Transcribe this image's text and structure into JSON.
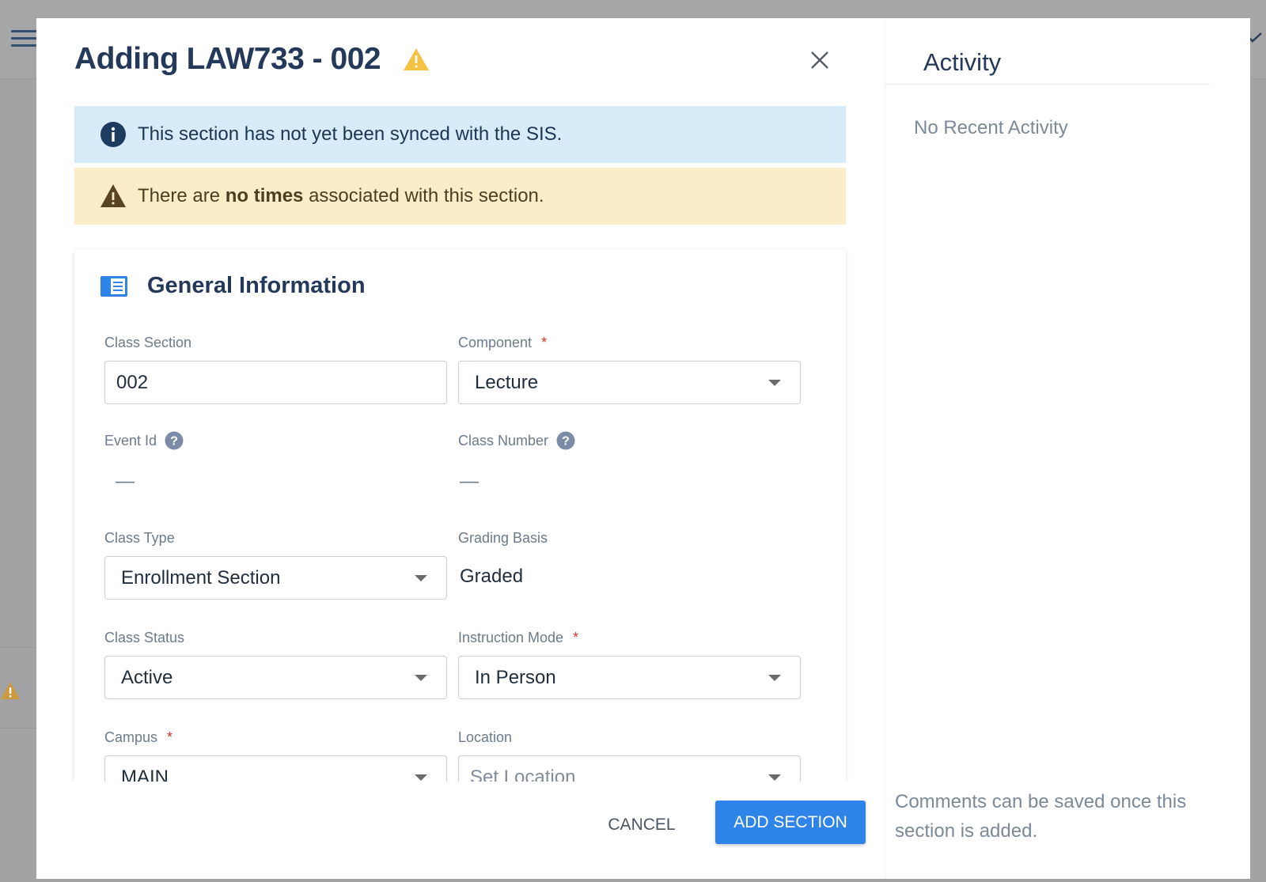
{
  "modal": {
    "title": "Adding LAW733 - 002"
  },
  "alerts": {
    "info_text": "This section has not yet been synced with the SIS.",
    "warn_prefix": "There are ",
    "warn_bold": "no times",
    "warn_suffix": " associated with this section."
  },
  "general": {
    "heading": "General Information",
    "class_section": {
      "label": "Class Section",
      "value": "002"
    },
    "component": {
      "label": "Component",
      "required": "*",
      "value": "Lecture"
    },
    "event_id": {
      "label": "Event Id",
      "value": "—"
    },
    "class_number": {
      "label": "Class Number",
      "value": "—"
    },
    "class_type": {
      "label": "Class Type",
      "value": "Enrollment Section"
    },
    "grading_basis": {
      "label": "Grading Basis",
      "value": "Graded"
    },
    "class_status": {
      "label": "Class Status",
      "value": "Active"
    },
    "instruction_mode": {
      "label": "Instruction Mode",
      "required": "*",
      "value": "In Person"
    },
    "campus": {
      "label": "Campus",
      "required": "*",
      "value": "MAIN"
    },
    "location": {
      "label": "Location",
      "placeholder": "Set Location"
    }
  },
  "footer": {
    "cancel_label": "CANCEL",
    "add_label": "ADD SECTION"
  },
  "activity": {
    "title": "Activity",
    "empty_text": "No Recent Activity",
    "comment_note": "Comments can be saved once this section is added."
  },
  "colors": {
    "primary_button": "#2f84ea",
    "info_bg": "#d7ebf8",
    "warn_bg": "#fcedc9",
    "title": "#24395a",
    "required": "#d9342b"
  },
  "icons": [
    "menu-icon",
    "warning-icon",
    "close-icon",
    "info-icon",
    "book-icon",
    "help-icon",
    "chevron-down-icon"
  ]
}
